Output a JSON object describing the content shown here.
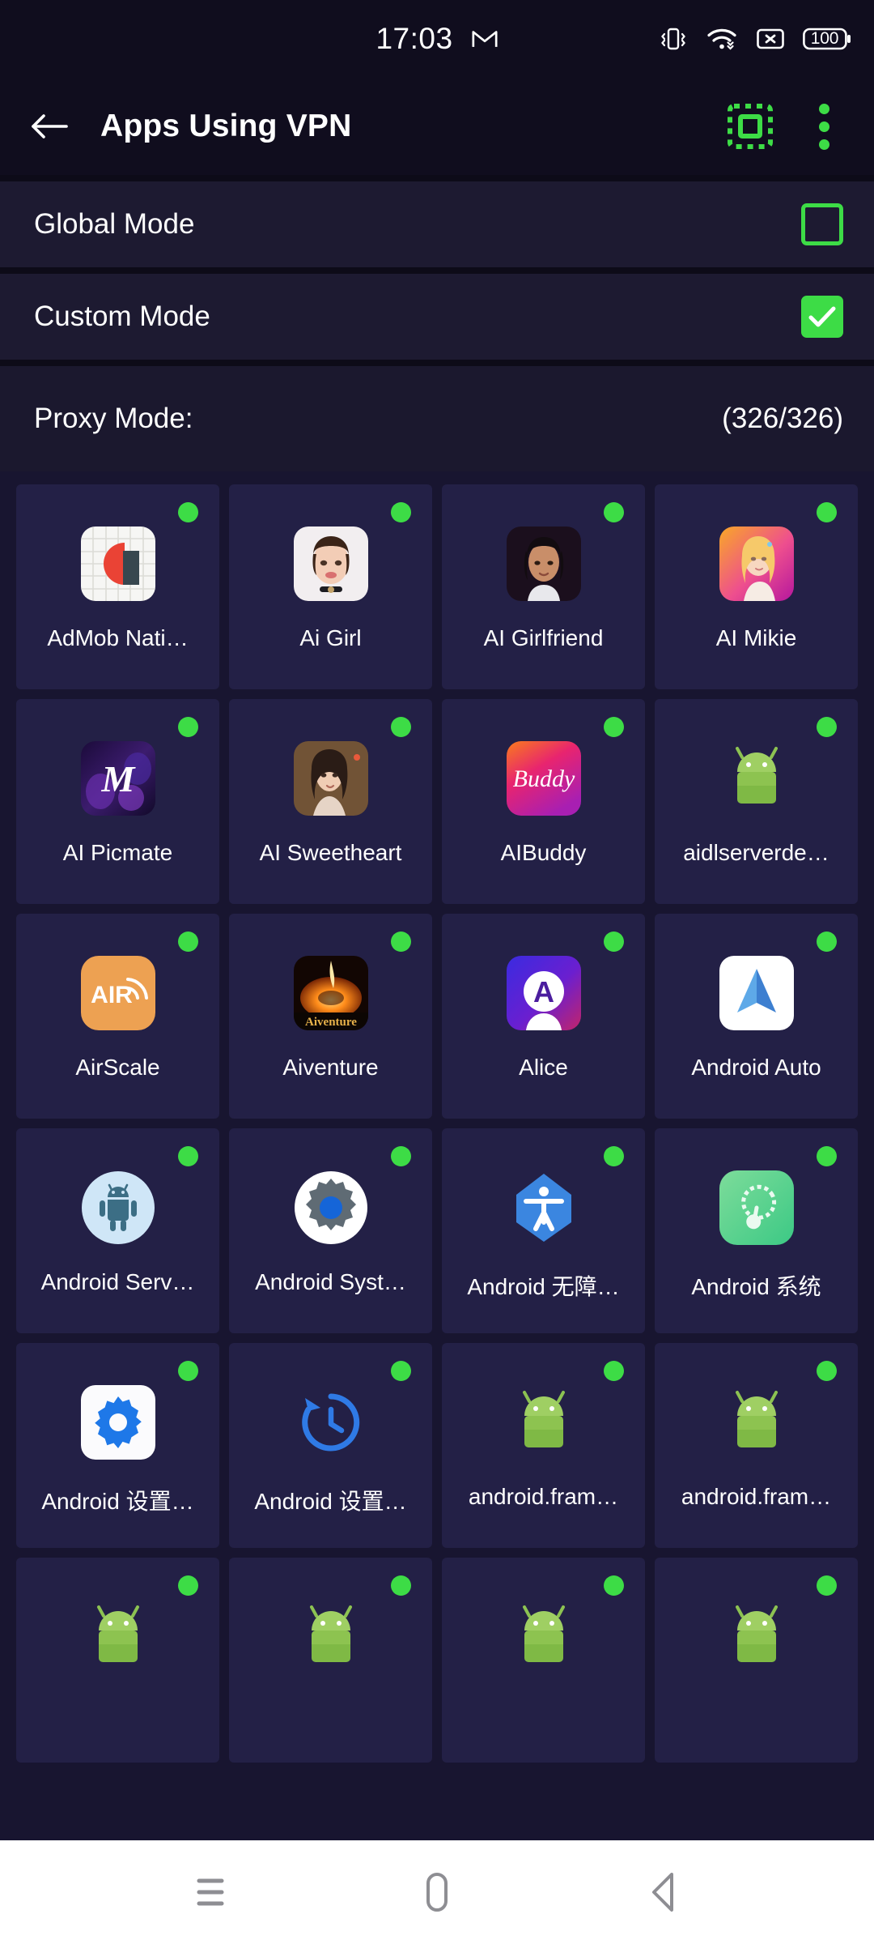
{
  "status_bar": {
    "clock": "17:03",
    "icons": [
      "gmail-icon",
      "vibrate-icon",
      "wifi-icon",
      "no-sim-icon",
      "battery-icon"
    ],
    "battery_level": "100"
  },
  "app_bar": {
    "back_label": "Back",
    "title": "Apps Using VPN",
    "select_all_label": "Select All",
    "overflow_label": "More options"
  },
  "modes": [
    {
      "label": "Global Mode",
      "checked": false
    },
    {
      "label": "Custom Mode",
      "checked": true
    }
  ],
  "proxy": {
    "label": "Proxy Mode:",
    "count": "(326/326)",
    "selected": 326,
    "total": 326
  },
  "colors": {
    "accent_green": "#3ddc46",
    "status_bg": "#100d1e",
    "row_bg": "#1d1a31",
    "grid_bg": "#181530",
    "tile_bg": "#232046",
    "text": "#ffffff"
  },
  "apps": [
    {
      "name": "AdMob Nati…",
      "icon": "admob-icon",
      "enabled": true
    },
    {
      "name": "Ai Girl",
      "icon": "ai-girl-icon",
      "enabled": true
    },
    {
      "name": "AI Girlfriend",
      "icon": "ai-girlfriend-icon",
      "enabled": true
    },
    {
      "name": "AI Mikie",
      "icon": "ai-mikie-icon",
      "enabled": true
    },
    {
      "name": "AI Picmate",
      "icon": "ai-picmate-icon",
      "enabled": true
    },
    {
      "name": "AI Sweetheart",
      "icon": "ai-sweetheart-icon",
      "enabled": true
    },
    {
      "name": "AIBuddy",
      "icon": "aibuddy-icon",
      "enabled": true
    },
    {
      "name": "aidlserverde…",
      "icon": "android-robot-icon",
      "enabled": true
    },
    {
      "name": "AirScale",
      "icon": "airscale-icon",
      "enabled": true
    },
    {
      "name": "Aiventure",
      "icon": "aiventure-icon",
      "enabled": true
    },
    {
      "name": "Alice",
      "icon": "alice-icon",
      "enabled": true
    },
    {
      "name": "Android Auto",
      "icon": "android-auto-icon",
      "enabled": true
    },
    {
      "name": "Android Serv…",
      "icon": "android-services-icon",
      "enabled": true
    },
    {
      "name": "Android Syst…",
      "icon": "android-system-gear-icon",
      "enabled": true
    },
    {
      "name": "Android 无障…",
      "icon": "accessibility-icon",
      "enabled": true
    },
    {
      "name": "Android 系统",
      "icon": "android-system-green-icon",
      "enabled": true
    },
    {
      "name": "Android 设置…",
      "icon": "settings-gear-icon",
      "enabled": true
    },
    {
      "name": "Android 设置…",
      "icon": "history-clock-icon",
      "enabled": true
    },
    {
      "name": "android.fram…",
      "icon": "android-robot-icon",
      "enabled": true
    },
    {
      "name": "android.fram…",
      "icon": "android-robot-icon",
      "enabled": true
    },
    {
      "name": "",
      "icon": "android-robot-icon",
      "enabled": true
    },
    {
      "name": "",
      "icon": "android-robot-icon",
      "enabled": true
    },
    {
      "name": "",
      "icon": "android-robot-icon",
      "enabled": true
    },
    {
      "name": "",
      "icon": "android-robot-icon",
      "enabled": true
    }
  ],
  "nav_bar": {
    "recents_label": "Recents",
    "home_label": "Home",
    "back_label": "Back"
  }
}
